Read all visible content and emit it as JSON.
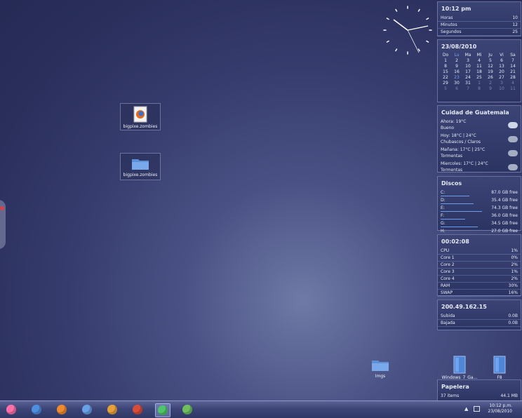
{
  "desktop": {
    "icons": [
      {
        "label": "bigpixe.zombies",
        "icon": "firefox-file-icon"
      },
      {
        "label": "bigpixe.zombies",
        "icon": "folder-icon"
      },
      {
        "label": "Imgs",
        "icon": "folder-icon"
      },
      {
        "label": "Windows_7_Ga...",
        "icon": "document-icon"
      },
      {
        "label": "F8",
        "icon": "document-icon"
      }
    ]
  },
  "clock_widget": {
    "time": "10:12 pm",
    "rows": [
      {
        "label": "Horas",
        "value": "10"
      },
      {
        "label": "Minutos",
        "value": "12"
      },
      {
        "label": "Segundos",
        "value": "25"
      }
    ]
  },
  "calendar_widget": {
    "date": "23/08/2010",
    "weekdays": [
      "Do",
      "Lu",
      "Ma",
      "Mi",
      "Ju",
      "Vi",
      "Sa"
    ],
    "weeks": [
      [
        "1",
        "2",
        "3",
        "4",
        "5",
        "6",
        "7"
      ],
      [
        "8",
        "9",
        "10",
        "11",
        "12",
        "13",
        "14"
      ],
      [
        "15",
        "16",
        "17",
        "18",
        "19",
        "20",
        "21"
      ],
      [
        "22",
        "23",
        "24",
        "25",
        "26",
        "27",
        "28"
      ],
      [
        "29",
        "30",
        "31",
        "1",
        "2",
        "3",
        "4"
      ],
      [
        "5",
        "6",
        "7",
        "8",
        "9",
        "10",
        "11"
      ]
    ]
  },
  "weather_widget": {
    "city": "Cuidad de Guatemala",
    "entries": [
      {
        "line1": "Ahora:  19°C",
        "line2": "Bueno",
        "icon": "cloudy-icon"
      },
      {
        "line1": "Hoy:  18°C | 24°C",
        "line2": "Chubascos / Claros",
        "icon": "rain-icon"
      },
      {
        "line1": "Mañana:  17°C | 25°C",
        "line2": "Tormentas",
        "icon": "storm-icon"
      },
      {
        "line1": "Miercoles:  17°C | 24°C",
        "line2": "Tormentas",
        "icon": "storm-icon"
      }
    ]
  },
  "disks_widget": {
    "title": "Discos",
    "disks": [
      {
        "drive": "C:",
        "free": "87.0 GB free",
        "used": 0.35
      },
      {
        "drive": "D:",
        "free": "35.4 GB free",
        "used": 0.4
      },
      {
        "drive": "E:",
        "free": "74.3 GB free",
        "used": 0.5
      },
      {
        "drive": "F:",
        "free": "36.0 GB free",
        "used": 0.3
      },
      {
        "drive": "G:",
        "free": "34.5 GB free",
        "used": 0.45
      },
      {
        "drive": "H:",
        "free": "27.0 GB free",
        "used": 0.55
      }
    ]
  },
  "system_widget": {
    "uptime": "00:02:08",
    "rows": [
      {
        "label": "CPU",
        "value": "1%"
      },
      {
        "label": "Core 1",
        "value": "0%"
      },
      {
        "label": "Core 2",
        "value": "2%"
      },
      {
        "label": "Core 3",
        "value": "1%"
      },
      {
        "label": "Core 4",
        "value": "2%"
      },
      {
        "label": "RAM",
        "value": "30%"
      },
      {
        "label": "SWAP",
        "value": "16%"
      }
    ]
  },
  "network_widget": {
    "ip": "200.49.162.15",
    "rows": [
      {
        "label": "Subida",
        "value": "0.0B"
      },
      {
        "label": "Bajada",
        "value": "0.0B"
      }
    ]
  },
  "recycle_widget": {
    "title": "Papelera",
    "items": "37 items",
    "size": "44.1 MB"
  },
  "taskbar": {
    "apps": [
      {
        "name": "start-orb-icon",
        "color": "#ff6fa8"
      },
      {
        "name": "internet-explorer-icon",
        "color": "#4f8fe0"
      },
      {
        "name": "firefox-icon",
        "color": "#f08a2c"
      },
      {
        "name": "file-explorer-icon",
        "color": "#6aa0e8"
      },
      {
        "name": "winamp-icon",
        "color": "#e8a13a"
      },
      {
        "name": "media-player-icon",
        "color": "#d94c3a"
      },
      {
        "name": "messenger-icon",
        "color": "#4fc46a"
      },
      {
        "name": "globe-icon",
        "color": "#6fbf5f"
      }
    ],
    "tray_time": "10:12 p.m.",
    "tray_date": "23/08/2010"
  }
}
